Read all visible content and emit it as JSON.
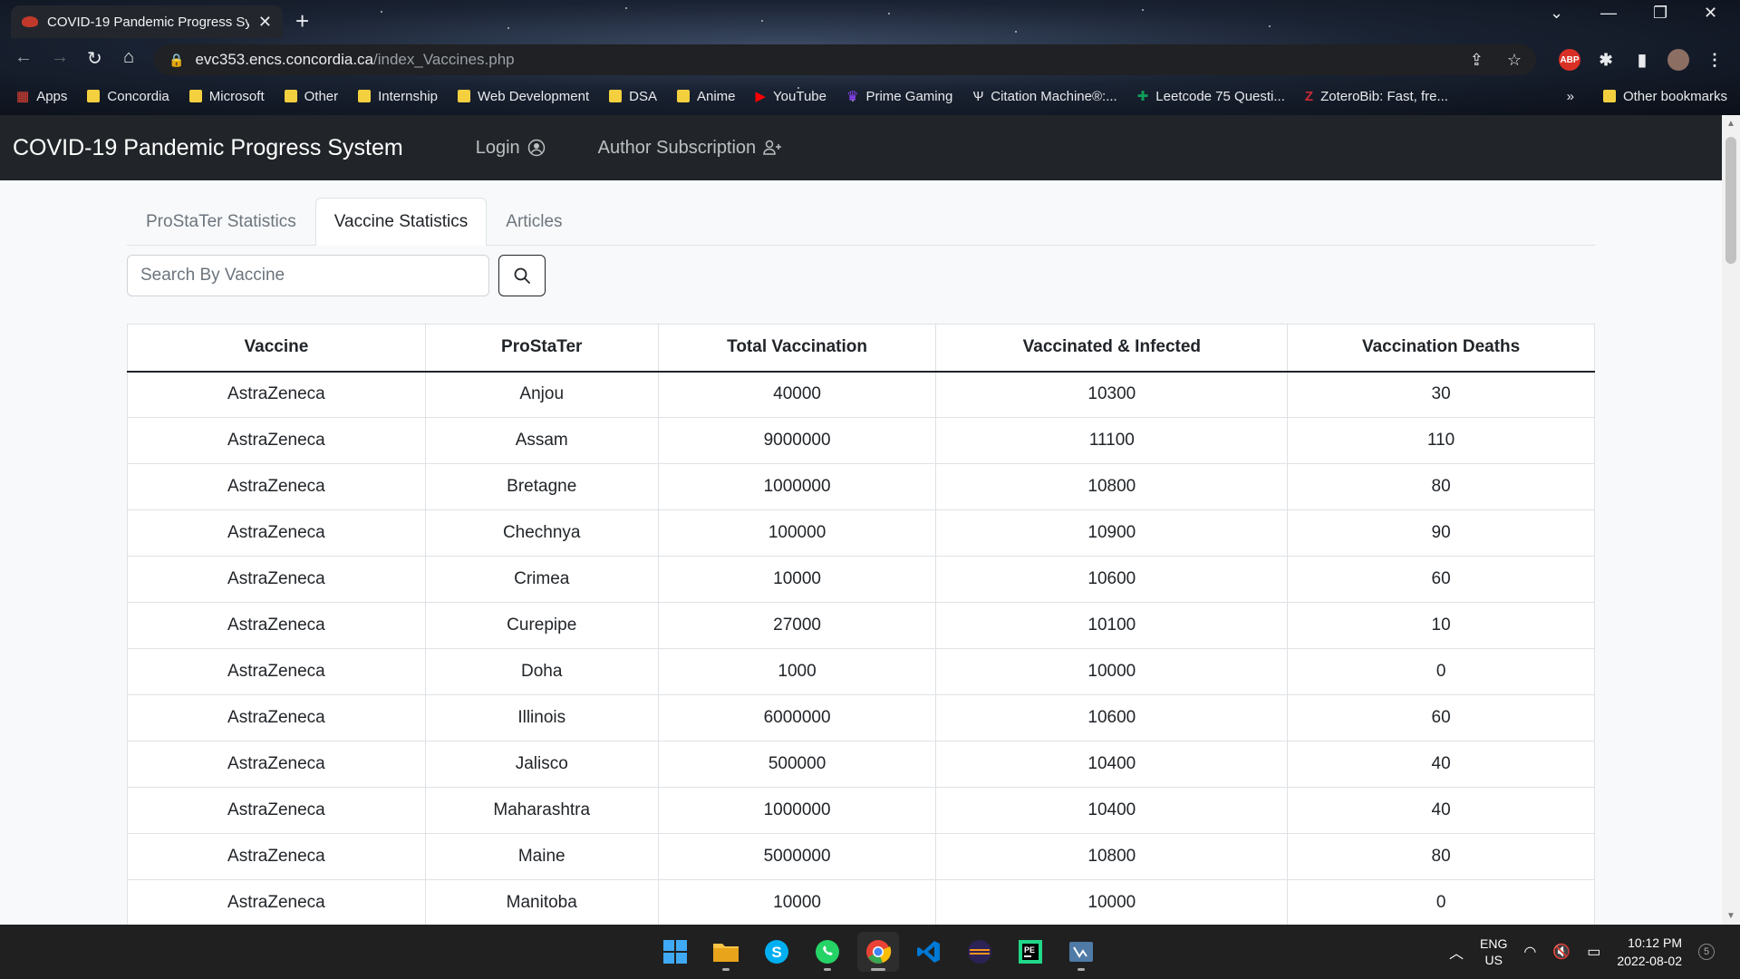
{
  "browser": {
    "tab_title": "COVID-19 Pandemic Progress Sy",
    "url_host": "evc353.encs.concordia.ca",
    "url_path": "/index_Vaccines.php",
    "bookmarks": [
      "Apps",
      "Concordia",
      "Microsoft",
      "Other",
      "Internship",
      "Web Development",
      "DSA",
      "Anime",
      "YouTube",
      "Prime Gaming",
      "Citation Machine®:...",
      "Leetcode 75 Questi...",
      "ZoteroBib: Fast, fre..."
    ],
    "other_bookmarks": "Other bookmarks",
    "more": "»"
  },
  "navbar": {
    "brand": "COVID-19 Pandemic Progress System",
    "login": "Login",
    "author": "Author Subscription"
  },
  "tabs": [
    "ProStaTer Statistics",
    "Vaccine Statistics",
    "Articles"
  ],
  "search": {
    "placeholder": "Search By Vaccine"
  },
  "table": {
    "headers": [
      "Vaccine",
      "ProStaTer",
      "Total Vaccination",
      "Vaccinated & Infected",
      "Vaccination Deaths"
    ],
    "rows": [
      [
        "AstraZeneca",
        "Anjou",
        "40000",
        "10300",
        "30"
      ],
      [
        "AstraZeneca",
        "Assam",
        "9000000",
        "11100",
        "110"
      ],
      [
        "AstraZeneca",
        "Bretagne",
        "1000000",
        "10800",
        "80"
      ],
      [
        "AstraZeneca",
        "Chechnya",
        "100000",
        "10900",
        "90"
      ],
      [
        "AstraZeneca",
        "Crimea",
        "10000",
        "10600",
        "60"
      ],
      [
        "AstraZeneca",
        "Curepipe",
        "27000",
        "10100",
        "10"
      ],
      [
        "AstraZeneca",
        "Doha",
        "1000",
        "10000",
        "0"
      ],
      [
        "AstraZeneca",
        "Illinois",
        "6000000",
        "10600",
        "60"
      ],
      [
        "AstraZeneca",
        "Jalisco",
        "500000",
        "10400",
        "40"
      ],
      [
        "AstraZeneca",
        "Maharashtra",
        "1000000",
        "10400",
        "40"
      ],
      [
        "AstraZeneca",
        "Maine",
        "5000000",
        "10800",
        "80"
      ],
      [
        "AstraZeneca",
        "Manitoba",
        "10000",
        "10000",
        "0"
      ]
    ]
  },
  "taskbar": {
    "lang_top": "ENG",
    "lang_bottom": "US",
    "time": "10:12 PM",
    "date": "2022-08-02",
    "notification_count": "5"
  }
}
